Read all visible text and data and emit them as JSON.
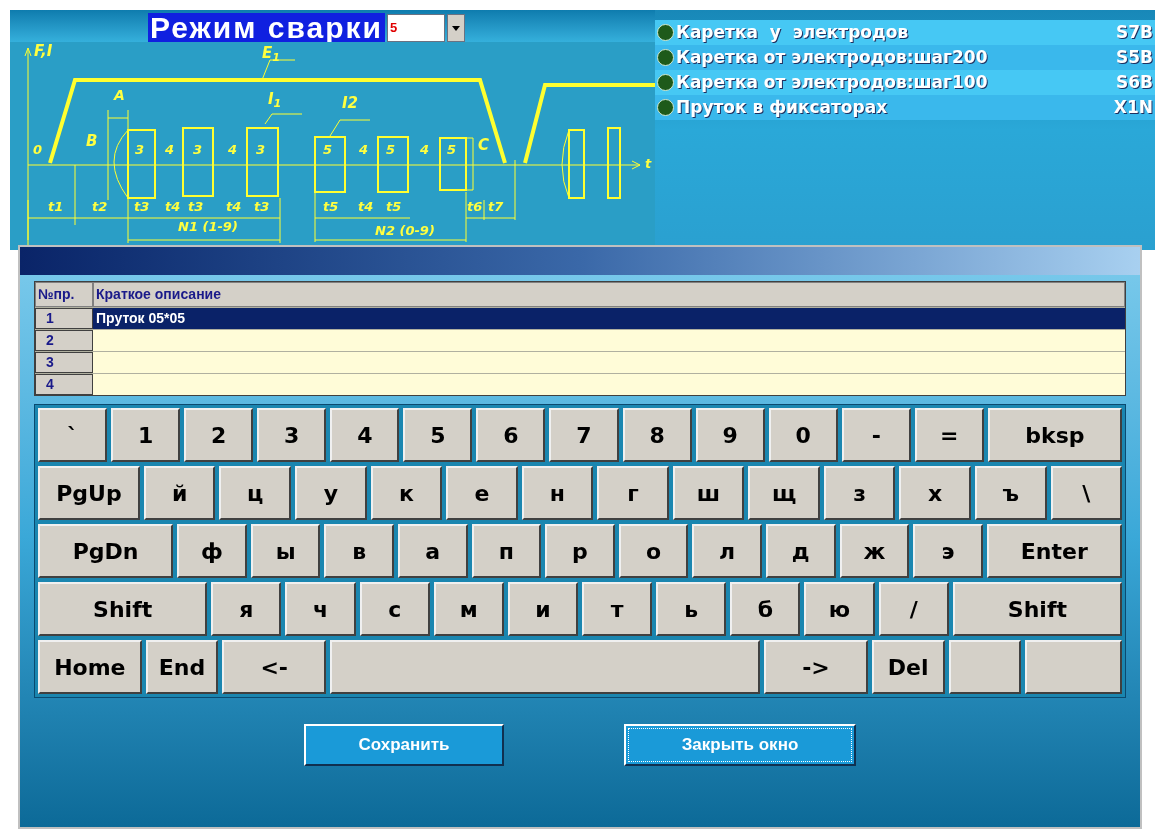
{
  "header": {
    "title": "Режим сварки",
    "mode_select": {
      "value": "5"
    }
  },
  "diagram": {
    "labels": [
      "F,I",
      "E$_{1}$",
      "A",
      "B",
      "3",
      "4",
      "3",
      "4",
      "3",
      "I$_{1}$",
      "I2",
      "5",
      "4",
      "5",
      "4",
      "5",
      "C",
      "0",
      "t",
      "t1",
      "t2",
      "t3",
      "t4",
      "t3",
      "t4",
      "t3",
      "t5",
      "t4",
      "t5",
      "t6",
      "t7",
      "N1 (1-9)",
      "N2 (0-9)"
    ]
  },
  "signals": [
    {
      "label": "Каретка  у  электродов",
      "code": "S7B"
    },
    {
      "label": "Каретка от электродов:шаг200",
      "code": "S5B"
    },
    {
      "label": "Каретка от электродов:шаг100",
      "code": "S6B"
    },
    {
      "label": "Пруток в фиксаторах",
      "code": "X1N"
    }
  ],
  "dialog": {
    "table": {
      "columns": [
        "№пр.",
        "Краткое описание"
      ],
      "rows": [
        {
          "number": "1",
          "description": "Пруток 05*05",
          "selected": true
        },
        {
          "number": "2",
          "selected": false
        },
        {
          "number": "3",
          "selected": false
        },
        {
          "number": "4",
          "selected": false
        }
      ]
    },
    "keyboard": {
      "rows": [
        {
          "keys": [
            {
              "label": "`"
            },
            {
              "label": "1"
            },
            {
              "label": "2"
            },
            {
              "label": "3"
            },
            {
              "label": "4"
            },
            {
              "label": "5"
            },
            {
              "label": "6"
            },
            {
              "label": "7"
            },
            {
              "label": "8"
            },
            {
              "label": "9"
            },
            {
              "label": "0"
            },
            {
              "label": "-"
            },
            {
              "label": "="
            },
            {
              "label": "bksp",
              "kind": "wide"
            }
          ]
        },
        {
          "keys": [
            {
              "label": "PgUp",
              "kind": "mid"
            },
            {
              "label": "й"
            },
            {
              "label": "ц"
            },
            {
              "label": "у"
            },
            {
              "label": "к"
            },
            {
              "label": "е"
            },
            {
              "label": "н"
            },
            {
              "label": "г"
            },
            {
              "label": "ш"
            },
            {
              "label": "щ"
            },
            {
              "label": "з"
            },
            {
              "label": "х"
            },
            {
              "label": "ъ"
            },
            {
              "label": "\\"
            }
          ]
        },
        {
          "keys": [
            {
              "label": "PgDn",
              "kind": "wide"
            },
            {
              "label": "ф"
            },
            {
              "label": "ы"
            },
            {
              "label": "в"
            },
            {
              "label": "а"
            },
            {
              "label": "п"
            },
            {
              "label": "р"
            },
            {
              "label": "о"
            },
            {
              "label": "л"
            },
            {
              "label": "д"
            },
            {
              "label": "ж"
            },
            {
              "label": "э"
            },
            {
              "label": "Enter",
              "kind": "wide"
            }
          ]
        },
        {
          "keys": [
            {
              "label": "Shift",
              "kind": "xwide"
            },
            {
              "label": "я"
            },
            {
              "label": "ч"
            },
            {
              "label": "с"
            },
            {
              "label": "м"
            },
            {
              "label": "и"
            },
            {
              "label": "т"
            },
            {
              "label": "ь"
            },
            {
              "label": "б"
            },
            {
              "label": "ю"
            },
            {
              "label": "/"
            },
            {
              "label": "Shift",
              "kind": "xwide"
            }
          ]
        },
        {
          "keys": [
            {
              "label": "Home",
              "kind": "mid"
            },
            {
              "label": "End",
              "kind": "small"
            },
            {
              "label": "<-",
              "kind": "mid"
            },
            {
              "kind": "space"
            },
            {
              "label": "->",
              "kind": "mid"
            },
            {
              "label": "Del"
            },
            {
              "kind": "blank"
            },
            {
              "kind": "blank-mid"
            }
          ]
        }
      ]
    },
    "buttons": [
      {
        "label": "Сохранить",
        "focused": false
      },
      {
        "label": "Закрыть окно",
        "focused": true
      }
    ]
  }
}
